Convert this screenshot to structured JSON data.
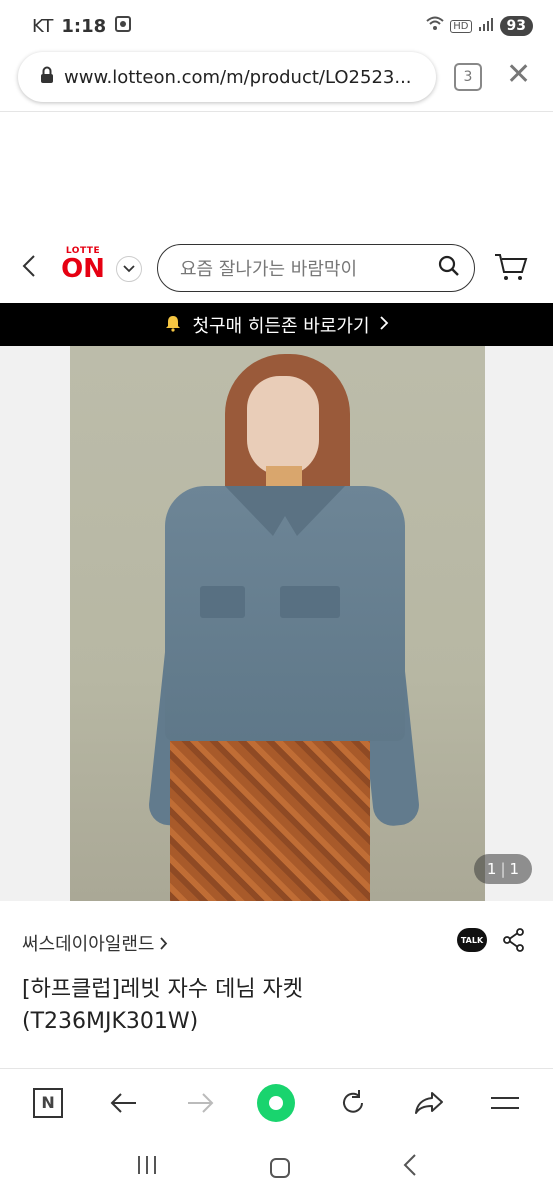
{
  "status_bar": {
    "carrier": "KT",
    "time": "1:18",
    "network": "HD",
    "battery": "93"
  },
  "url_bar": {
    "url": "www.lotteon.com/m/product/LO2523...",
    "tab_count": "3"
  },
  "site_header": {
    "logo_top": "LOTTE",
    "logo_main": "ON",
    "search_placeholder": "요즘 잘나가는 바람막이"
  },
  "promo_banner": {
    "text": "첫구매 히든존 바로가기"
  },
  "gallery": {
    "current": "1",
    "total": "1"
  },
  "product": {
    "brand": "써스데이아일랜드",
    "title_line1": "[하프클럽]레빗 자수 데님 자켓",
    "title_line2": "(T236MJK301W)"
  },
  "toolbar": {
    "n_label": "N"
  },
  "colors": {
    "brand_red": "#e60012",
    "home_green": "#19d46e",
    "banner_bg": "#000000"
  }
}
